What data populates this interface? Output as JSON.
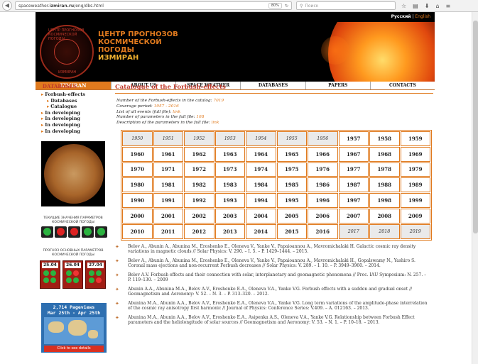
{
  "browser": {
    "url_domain": "spaceweather.",
    "url_bold": "izmiran.ru",
    "url_path": "/eng/dbs.html",
    "zoom": "80%",
    "search_placeholder": "Поиск"
  },
  "lang": {
    "ru": "Русский",
    "sep": " | ",
    "en": "English"
  },
  "header": {
    "line1": "ЦЕНТР ПРОГНОЗОВ",
    "line2": "КОСМИЧЕСКОЙ",
    "line3": "ПОГОДЫ",
    "line4": "ИЗМИРАН",
    "ring_top": "ЦЕНТР ПРОГНОЗОВ КОСМИЧЕСКОЙ ПОГОДЫ",
    "ring_bottom": "ИЗМИРАН"
  },
  "nav": {
    "home": "IZMIRAN",
    "items": [
      "ABOUT US",
      "SPACE WEATHER",
      "DATABASES",
      "PAPERS",
      "CONTACTS"
    ]
  },
  "sidebar": {
    "databases": "DATABASES",
    "forbush": "Forbush-effects",
    "sub": [
      "Databases",
      "Catalogue"
    ],
    "developing": [
      "In developing",
      "In developing",
      "In developing",
      "In developing"
    ],
    "caption_params": "ТЕКУЩИЕ ЗНАЧЕНИЯ ПАРАМЕТРОВ КОСМИЧЕСКОЙ ПОГОДЫ",
    "caption_forecast": "ПРОГНОЗ ОСНОВНЫХ ПАРАМЕТРОВ КОСМИЧЕСКОЙ ПОГОДЫ",
    "forecast_dates": [
      "25.04",
      "26.04",
      "27.04"
    ],
    "pageviews_line1": "2,714 Pageviews",
    "pageviews_line2": "Mar 25th - Apr 25th",
    "pageviews_click": "Click to see details"
  },
  "main": {
    "title": "Catalogue of the Forbush-effects",
    "info": [
      {
        "label": "Number of the Forbush-effects in the catalog: ",
        "value": "7019"
      },
      {
        "label": "Coverage period: ",
        "value": "1957 - 2016"
      },
      {
        "label": "List of all events (full file): ",
        "value": "link"
      },
      {
        "label": "Number of parameters in the full file: ",
        "value": "108"
      },
      {
        "label": "Description of the parameters in the full file: ",
        "value": "link"
      }
    ],
    "years": [
      [
        "1950",
        "1951",
        "1952",
        "1953",
        "1954",
        "1955",
        "1956",
        "1957",
        "1958",
        "1959"
      ],
      [
        "1960",
        "1961",
        "1962",
        "1963",
        "1964",
        "1965",
        "1966",
        "1967",
        "1968",
        "1969"
      ],
      [
        "1970",
        "1971",
        "1972",
        "1973",
        "1974",
        "1975",
        "1976",
        "1977",
        "1978",
        "1979"
      ],
      [
        "1980",
        "1981",
        "1982",
        "1983",
        "1984",
        "1985",
        "1986",
        "1987",
        "1988",
        "1989"
      ],
      [
        "1990",
        "1991",
        "1992",
        "1993",
        "1994",
        "1995",
        "1996",
        "1997",
        "1998",
        "1999"
      ],
      [
        "2000",
        "2001",
        "2002",
        "2003",
        "2004",
        "2005",
        "2006",
        "2007",
        "2008",
        "2009"
      ],
      [
        "2010",
        "2011",
        "2012",
        "2013",
        "2014",
        "2015",
        "2016",
        "2017",
        "2018",
        "2019"
      ]
    ],
    "refs": [
      "Belov A., Abunin A., Abunina M., Eroshenko E., Oleneva V., Yanke V., Papaioannou A., Mavromichalaki H. Galactic cosmic ray density variations in magnetic clouds // Solar Physics: V. 290. – I. 5. – P. 1429–1444. – 2015.",
      "Belov A., Abunin A., Abunina M., Eroshenko E., Oleneva V., Yanke V., Papaioannou A., Mavromichalaki H., Gopalswamy N., Yashiro S. Coronal mass ejections and non-recurrent Forbush decreases // Solar Physics: V. 289. – I. 10. – P. 3949–3960. – 2014.",
      "Belov A.V. Forbush effects and their connection with solar, interplanetary and geomagnetic phenomena // Proc. IAU Symposium: N. 257. – P. 119–130. – 2009",
      "Abunin A.A., Abunina M.A., Belov A.V., Eroshenko E.A., Oleneva V.A., Yanke V.G. Forbush effects with a sudden and gradual onset // Geomagnetism and Aeronomy: V. 52. – N. 3. – P. 313–320. – 2012.",
      "Abunina M.A., Abunin A.A., Belov A.V., Eroshenko E.A., Oleneva V.A., Yanke V.G. Long term variations of the amplitude-phase interrelation of the cosmic ray anisotropy first harmonic // Journal of Physics: Conference Series: V.409. – A. 012163. – 2013.",
      "Abunina M.A., Abunin A.A., Belov A.V., Eroshenko E.A., Asipenka A.S., Oleneva V.A., Yanke V.G. Relationship between Forbush Effect parameters and the heliolongitude of solar sources // Geomagnetism and Aeronomy: V. 53. – N. 1. – P. 10–18. – 2013."
    ]
  }
}
